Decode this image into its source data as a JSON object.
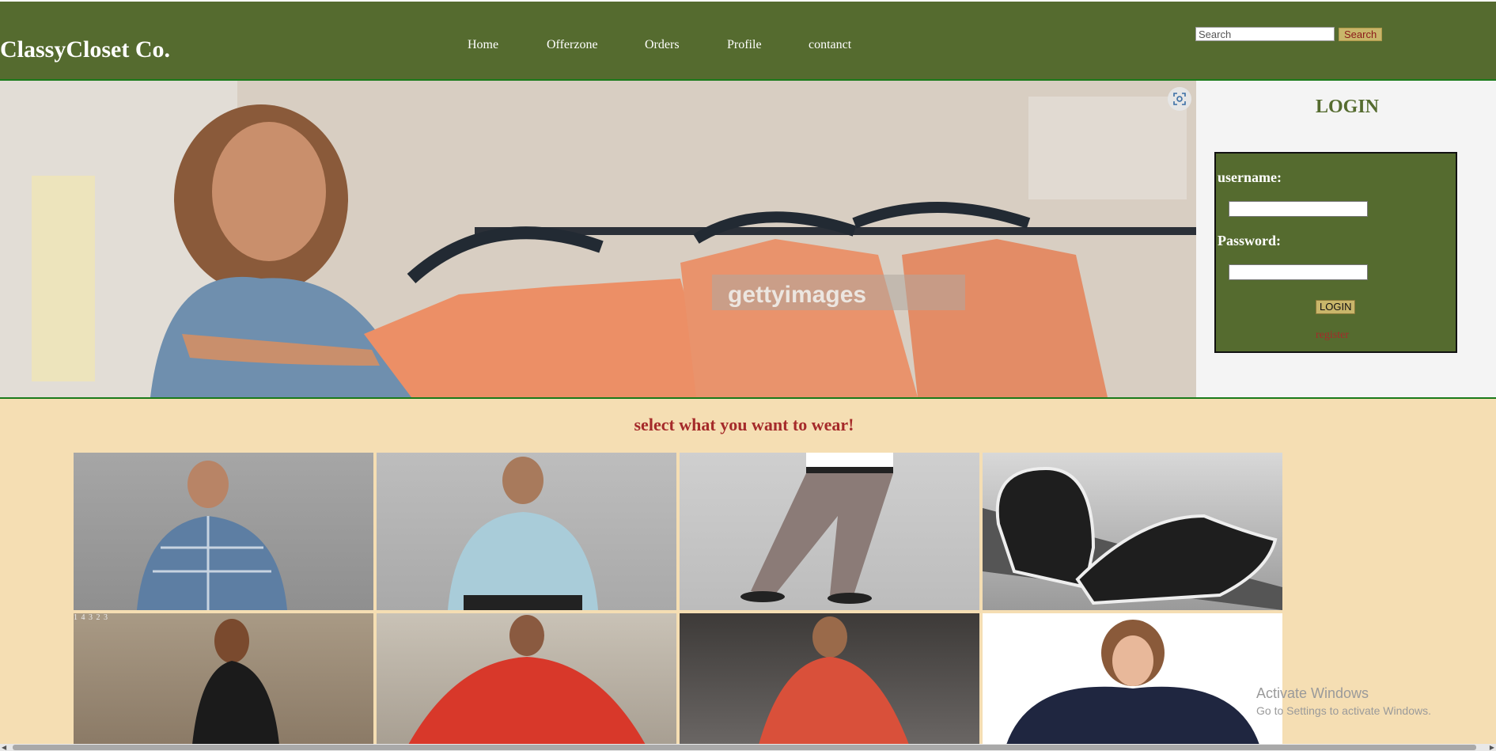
{
  "header": {
    "brand": "ClassyCloset Co.",
    "nav": [
      "Home",
      "Offerzone",
      "Orders",
      "Profile",
      "contanct"
    ],
    "search_placeholder": "Search",
    "search_button": "Search"
  },
  "hero": {
    "watermark": "gettyimages"
  },
  "login": {
    "title": "LOGIN",
    "username_label": "username:",
    "password_label": "Password:",
    "button": "LOGIN",
    "register_link": "register"
  },
  "products": {
    "title": "select what you want to wear!",
    "tile4_caption": "1 4 3 2 3"
  },
  "os_watermark": {
    "line1": "Activate Windows",
    "line2": "Go to Settings to activate Windows."
  },
  "colors": {
    "header_bg": "#556b2f",
    "page_bg": "#f5deb3",
    "accent_red": "#a52a2a",
    "button_gold": "#c9b66a"
  }
}
